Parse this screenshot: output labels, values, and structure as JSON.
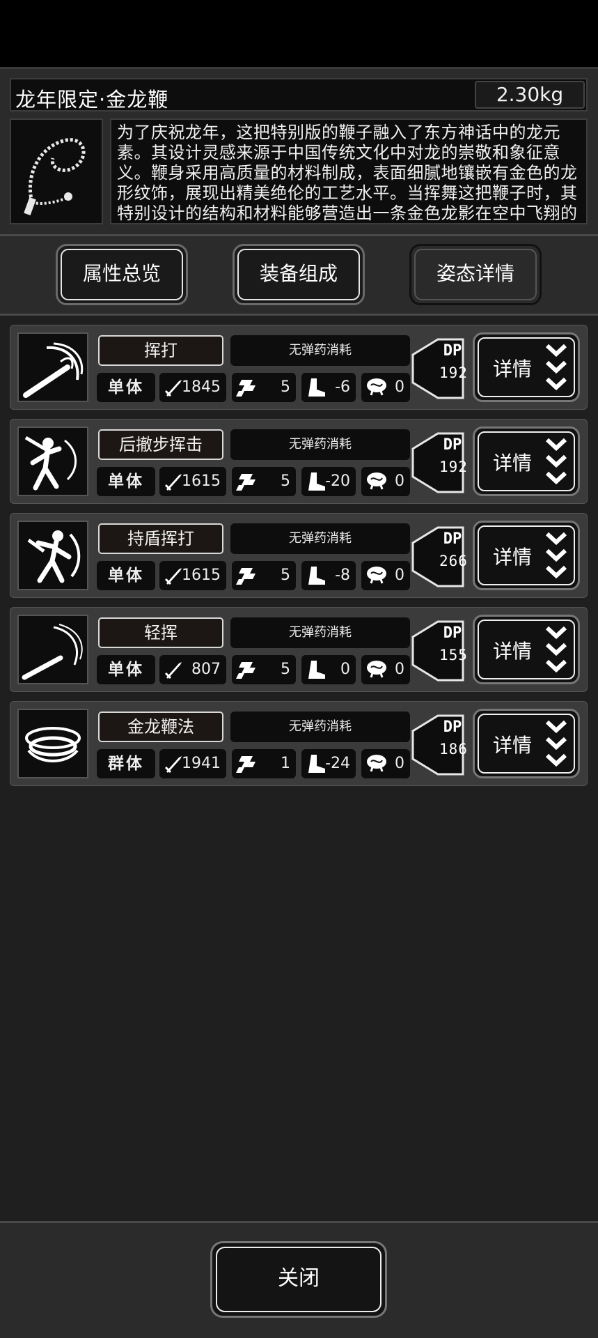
{
  "weapon": {
    "name": "龙年限定·金龙鞭",
    "weight": "2.30kg",
    "description": "为了庆祝龙年，这把特别版的鞭子融入了东方神话中的龙元素。其设计灵感来源于中国传统文化中对龙的崇敬和象征意义。鞭身采用高质量的材料制成，表面细腻地镶嵌有金色的龙形纹饰，展现出精美绝伦的工艺水平。当挥舞这把鞭子时，其特别设计的结构和材料能够营造出一条金色龙影在空中飞翔的视觉效果，为使"
  },
  "tabs": [
    {
      "label": "属性总览"
    },
    {
      "label": "装备组成"
    },
    {
      "label": "姿态详情"
    }
  ],
  "skills": [
    {
      "name": "挥打",
      "ammo": "无弹药消耗",
      "target": "单体",
      "attack": "1845",
      "speed": "5",
      "move": "-6",
      "crit": "0",
      "dp_label": "DP",
      "dp": "192",
      "detail": "详情"
    },
    {
      "name": "后撤步挥击",
      "ammo": "无弹药消耗",
      "target": "单体",
      "attack": "1615",
      "speed": "5",
      "move": "-20",
      "crit": "0",
      "dp_label": "DP",
      "dp": "192",
      "detail": "详情"
    },
    {
      "name": "持盾挥打",
      "ammo": "无弹药消耗",
      "target": "单体",
      "attack": "1615",
      "speed": "5",
      "move": "-8",
      "crit": "0",
      "dp_label": "DP",
      "dp": "266",
      "detail": "详情"
    },
    {
      "name": "轻挥",
      "ammo": "无弹药消耗",
      "target": "单体",
      "attack": "807",
      "speed": "5",
      "move": "0",
      "crit": "0",
      "dp_label": "DP",
      "dp": "155",
      "detail": "详情"
    },
    {
      "name": "金龙鞭法",
      "ammo": "无弹药消耗",
      "target": "群体",
      "attack": "1941",
      "speed": "1",
      "move": "-24",
      "crit": "0",
      "dp_label": "DP",
      "dp": "186",
      "detail": "详情"
    }
  ],
  "close_label": "关闭",
  "icons": {
    "weapon": "golden-dragon-whip-icon",
    "attack": "sword-icon",
    "speed": "checker-flag-icon",
    "move": "boot-icon",
    "crit": "brain-icon",
    "expand": "triple-chevron-down-icon"
  },
  "colors": {
    "background": "#2b2b2b",
    "panel": "#0d0d0d",
    "row": "#3b3b3b",
    "text": "#f2f2f2"
  }
}
